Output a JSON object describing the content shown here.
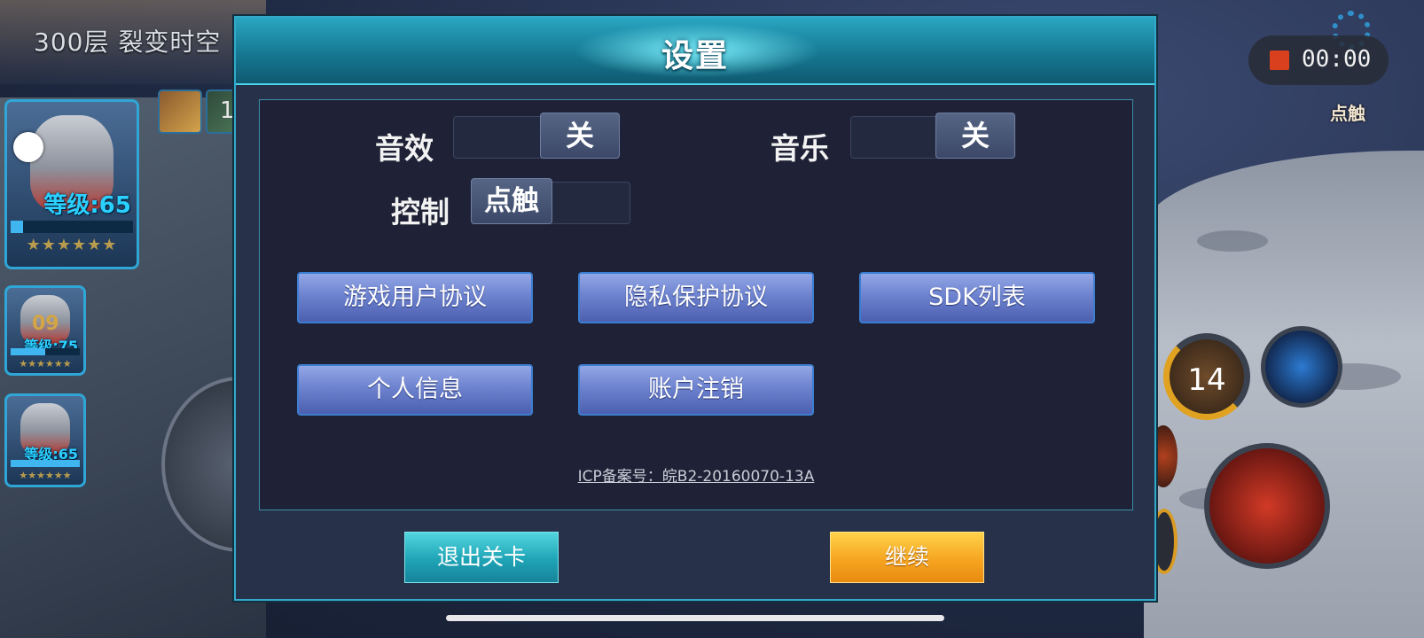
{
  "hud": {
    "level_title": "300层  裂变时空",
    "item_count": "1",
    "record_time": "00:00",
    "touch_badge": "点触",
    "skill_cooldown": "14"
  },
  "heroes": [
    {
      "level": "等级:65",
      "stars": "★★★★★★",
      "hp_fraction": 0.1
    },
    {
      "number": "09",
      "level": "等级:75",
      "stars": "★★★★★★",
      "hp_fraction": 0.5
    },
    {
      "level": "等级:65",
      "stars": "★★★★★★",
      "hp_fraction": 1.0
    }
  ],
  "settings": {
    "title": "设置",
    "sound_label": "音效",
    "sound_state": "关",
    "music_label": "音乐",
    "music_state": "关",
    "control_label": "控制",
    "control_state": "点触",
    "buttons": {
      "user_agreement": "游戏用户协议",
      "privacy": "隐私保护协议",
      "sdk_list": "SDK列表",
      "personal_info": "个人信息",
      "account_cancel": "账户注销"
    },
    "icp": "ICP备案号：皖B2-20160070-13A",
    "exit_label": "退出关卡",
    "continue_label": "继续"
  },
  "colors": {
    "accent_cyan": "#34a9c9",
    "button_blue": "#6d83cf",
    "continue_orange": "#f6a521",
    "exit_teal": "#1fa4b6"
  },
  "icons": [
    "gear-icon",
    "record-stop-icon",
    "skill-icon",
    "joystick"
  ]
}
